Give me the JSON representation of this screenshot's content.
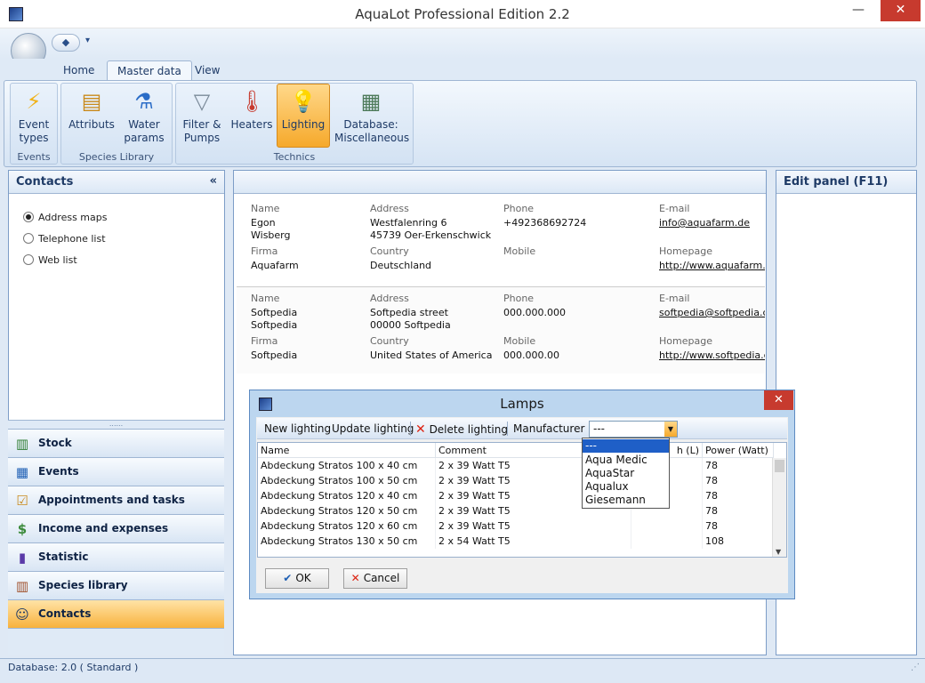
{
  "window": {
    "title": "AquaLot Professional Edition 2.2",
    "minimize": "—",
    "close": "✕"
  },
  "qat": {
    "arrow": "▾"
  },
  "tabs": [
    "Home",
    "Master data",
    "View"
  ],
  "ribbon": {
    "buttons": [
      {
        "label": "Event\ntypes",
        "icon": "lightning-icon"
      },
      {
        "label": "Attributs",
        "icon": "card-file-icon"
      },
      {
        "label": "Water\nparams",
        "icon": "flask-icon"
      },
      {
        "label": "Filter &\nPumps",
        "icon": "filter-icon"
      },
      {
        "label": "Heaters",
        "icon": "thermometer-icon"
      },
      {
        "label": "Lighting",
        "icon": "light-bulb-icon"
      },
      {
        "label": "Database:\nMiscellaneous",
        "icon": "chip-icon"
      }
    ],
    "groups": [
      "Events",
      "Species Library",
      "Technics"
    ]
  },
  "contacts_panel": {
    "title": "Contacts",
    "collapse": "«",
    "options": [
      "Address maps",
      "Telephone list",
      "Web list"
    ],
    "selected": "Address maps",
    "splitter": "......"
  },
  "nav": [
    {
      "label": "Stock",
      "icon": "stock-icon"
    },
    {
      "label": "Events",
      "icon": "calendar-icon"
    },
    {
      "label": "Appointments and tasks",
      "icon": "checklist-icon"
    },
    {
      "label": "Income and expenses",
      "icon": "money-icon"
    },
    {
      "label": "Statistic",
      "icon": "bar-chart-icon"
    },
    {
      "label": "Species library",
      "icon": "books-icon"
    },
    {
      "label": "Contacts",
      "icon": "contacts-icon"
    }
  ],
  "edit_panel": {
    "title": "Edit panel (F11)"
  },
  "labels": {
    "name": "Name",
    "address": "Address",
    "phone": "Phone",
    "email": "E-mail",
    "firma": "Firma",
    "country": "Country",
    "mobile": "Mobile",
    "homepage": "Homepage"
  },
  "contacts": [
    {
      "name1": "Egon",
      "name2": "Wisberg",
      "address1": "Westfalenring 6",
      "address2": "45739 Oer-Erkenschwick",
      "phone": "+492368692724",
      "email": "info@aquafarm.de",
      "firma": "Aquafarm",
      "country": "Deutschland",
      "mobile": "",
      "homepage": "http://www.aquafarm.de/"
    },
    {
      "name1": "Softpedia",
      "name2": "Softpedia",
      "address1": "Softpedia street",
      "address2": "00000 Softpedia",
      "phone": "000.000.000",
      "email": "softpedia@softpedia.com",
      "firma": "Softpedia",
      "country": "United States of America",
      "mobile": "000.000.00",
      "homepage": "http://www.softpedia.com"
    }
  ],
  "dialog": {
    "title": "Lamps",
    "close": "✕",
    "toolbar": {
      "new": "New lighting",
      "update": "Update lighting",
      "delete": "Delete lighting",
      "manufacturer": "Manufacturer",
      "manufacturer_value": "---",
      "combo_arrow": "▼"
    },
    "columns": [
      "Name",
      "Comment",
      "h (L)",
      "Power (Watt)"
    ],
    "rows": [
      [
        "Abdeckung Stratos 100 x 40 cm",
        "2 x 39 Watt T5",
        "",
        "78"
      ],
      [
        "Abdeckung Stratos 100 x 50 cm",
        "2 x 39 Watt T5",
        "",
        "78"
      ],
      [
        "Abdeckung Stratos 120 x 40 cm",
        "2 x 39 Watt T5",
        "",
        "78"
      ],
      [
        "Abdeckung Stratos 120 x 50 cm",
        "2 x 39 Watt T5",
        "",
        "78"
      ],
      [
        "Abdeckung Stratos 120 x 60 cm",
        "2 x 39 Watt T5",
        "",
        "78"
      ],
      [
        "Abdeckung Stratos 130 x 50 cm",
        "2 x 54 Watt T5",
        "",
        "108"
      ]
    ],
    "scroll_down": "▼",
    "ok": "OK",
    "cancel": "Cancel",
    "dropdown_options": [
      "---",
      "Aqua Medic",
      "AquaStar",
      "Aqualux",
      "Giesemann"
    ],
    "dropdown_selected": "---"
  },
  "status": {
    "text": "Database: 2.0 ( Standard )",
    "grip": "⋰"
  }
}
